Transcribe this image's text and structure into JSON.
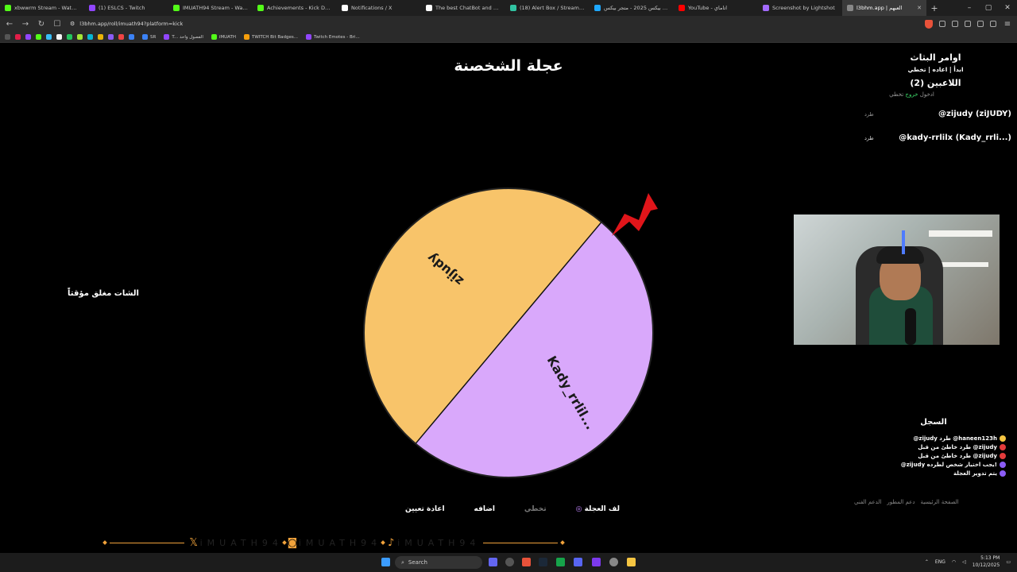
{
  "browser": {
    "tabs": [
      {
        "title": "xbwwrm Stream - Watch Li",
        "color": "#53fc18"
      },
      {
        "title": "(1) ESLCS - Twitch",
        "color": "#9146ff"
      },
      {
        "title": "IMUATH94 Stream - Watch",
        "color": "#53fc18"
      },
      {
        "title": "Achievements - Kick Dashboa",
        "color": "#53fc18"
      },
      {
        "title": "Notifications / X",
        "color": "#ffffff"
      },
      {
        "title": "The best ChatBot and Widgets",
        "color": "#ffffff"
      },
      {
        "title": "(18) Alert Box / Streamlabs",
        "color": "#31c3a2"
      },
      {
        "title": "جيرسي بيكس 2025 - متجر بيكس",
        "color": "#1ea8ff"
      },
      {
        "title": "YouTube - اتاماي",
        "color": "#ff0000"
      },
      {
        "title": "Screenshot by Lightshot",
        "color": "#a36bff"
      },
      {
        "title": "l3bhm.app | العبهم",
        "color": "#888888",
        "active": true
      }
    ],
    "new_tab": "+",
    "url": "l3bhm.app/roll/imuath94?platform=kick",
    "bookmarks": [
      {
        "label": "SR",
        "color": "#3b82f6"
      },
      {
        "label": "T... الفصول واحد",
        "color": "#9146ff"
      },
      {
        "label": "iMUATH",
        "color": "#53fc18"
      },
      {
        "label": "TWITCH Bit Badges...",
        "color": "#f59e0b"
      },
      {
        "label": "Twitch Emotes - Bri...",
        "color": "#9146ff"
      }
    ]
  },
  "page": {
    "title": "عجلة الشخصنة",
    "chat_closed": "الشات مغلق مؤقتاً",
    "wheel": {
      "segments": [
        {
          "label": "zijudy",
          "color": "#f8c46a"
        },
        {
          "label": "Kady_rrlil...",
          "color": "#d9a8fb"
        }
      ],
      "pointer_color": "#e0151a"
    },
    "commands": {
      "title": "اوامر البثاث",
      "list": "ابدأ | اعاده | تخطي"
    },
    "players": {
      "title": "اللاعبين (2)",
      "join": "ادخول",
      "leave": "خروج",
      "skip": "تخطي",
      "rows": [
        {
          "name": "@zijudy (ziJUDY)",
          "kick": "طرد"
        },
        {
          "name": "@kady-rrlilx (Kady_rrli...)",
          "kick": "طرد"
        }
      ]
    },
    "log": {
      "title": "السجل",
      "entries": [
        {
          "text": "@zijudy طرد @haneen123h",
          "icon_color": "#f5c542"
        },
        {
          "text": "طرد خاطئ من قبل @zijudy",
          "icon_color": "#e23b3b"
        },
        {
          "text": "طرد خاطئ من قبل @zijudy",
          "icon_color": "#e23b3b"
        },
        {
          "text": "@zijudy يجب اختيار شخص لطرده!",
          "icon_color": "#8b5cf6"
        },
        {
          "text": "يتم تدوير العجلة",
          "icon_color": "#8b5cf6"
        }
      ]
    },
    "footer_links": [
      "الصفحة الرئيسية",
      "دعم المطور",
      "الدعم الفني"
    ],
    "controls": {
      "spin": "لف العجلة",
      "skip": "تخطي",
      "add": "اضافه",
      "reset": "اعادة تعيين"
    },
    "social": {
      "handle": "iMUATH94",
      "accent": "#f0a23b"
    }
  },
  "taskbar": {
    "search": "Search",
    "language": "ENG",
    "time": "5:13 PM",
    "date": "10/12/2025"
  }
}
